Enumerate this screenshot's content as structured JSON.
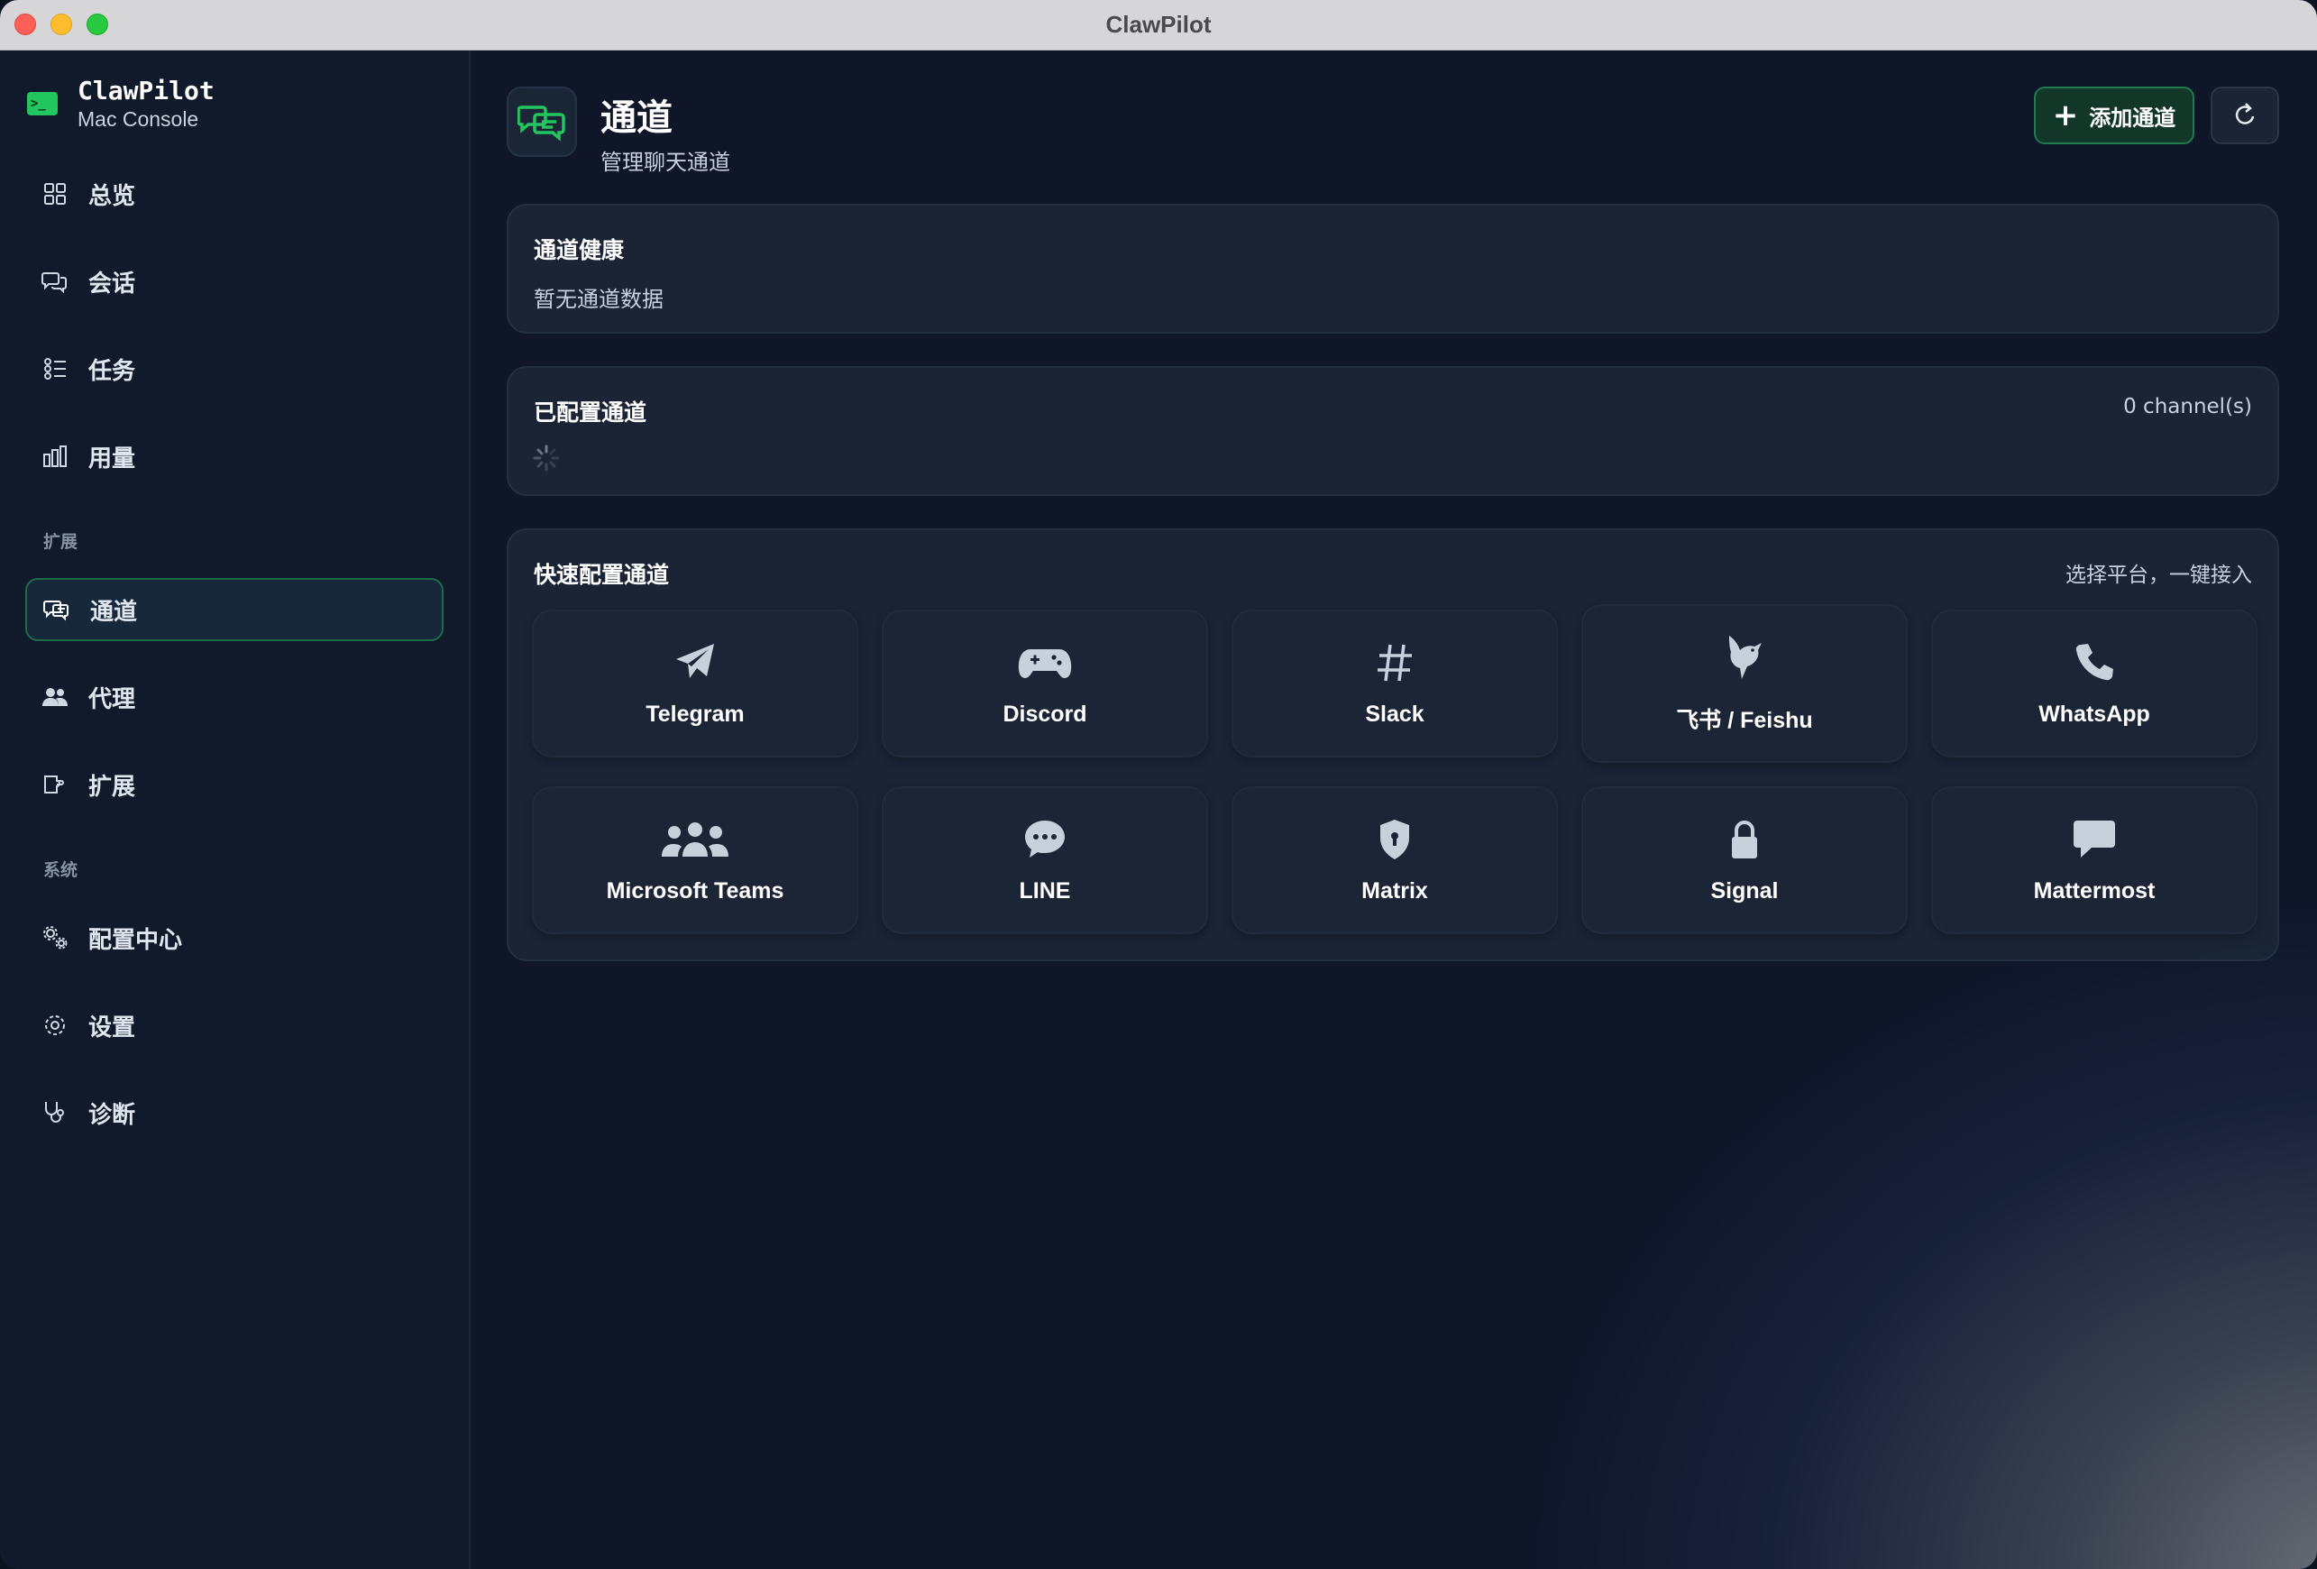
{
  "window": {
    "title": "ClawPilot"
  },
  "brand": {
    "name": "ClawPilot",
    "subtitle": "Mac Console",
    "icon": "terminal-icon"
  },
  "sidebar": {
    "items": [
      {
        "label": "总览",
        "icon": "grid-icon"
      },
      {
        "label": "会话",
        "icon": "chat-icon"
      },
      {
        "label": "任务",
        "icon": "task-list-icon"
      },
      {
        "label": "用量",
        "icon": "bar-chart-icon"
      }
    ],
    "section_ext": "扩展",
    "ext_items": [
      {
        "label": "通道",
        "icon": "channel-icon",
        "active": true
      },
      {
        "label": "代理",
        "icon": "users-icon"
      },
      {
        "label": "扩展",
        "icon": "plugin-icon"
      }
    ],
    "section_sys": "系统",
    "sys_items": [
      {
        "label": "配置中心",
        "icon": "gears-icon"
      },
      {
        "label": "设置",
        "icon": "gear-icon"
      },
      {
        "label": "诊断",
        "icon": "stethoscope-icon"
      }
    ]
  },
  "header": {
    "title": "通道",
    "subtitle": "管理聊天通道",
    "add_label": "添加通道"
  },
  "health": {
    "title": "通道健康",
    "empty": "暂无通道数据"
  },
  "configured": {
    "title": "已配置通道",
    "count": "0 channel(s)"
  },
  "quick": {
    "title": "快速配置通道",
    "hint": "选择平台，一键接入",
    "platforms": [
      {
        "label": "Telegram",
        "icon": "paper-plane-icon"
      },
      {
        "label": "Discord",
        "icon": "gamepad-icon"
      },
      {
        "label": "Slack",
        "icon": "hashtag-icon"
      },
      {
        "label": "飞书 / Feishu",
        "icon": "bird-icon"
      },
      {
        "label": "WhatsApp",
        "icon": "phone-icon"
      },
      {
        "label": "Microsoft Teams",
        "icon": "people-group-icon"
      },
      {
        "label": "LINE",
        "icon": "speech-bubble-dots-icon"
      },
      {
        "label": "Matrix",
        "icon": "shield-lock-icon"
      },
      {
        "label": "Signal",
        "icon": "padlock-icon"
      },
      {
        "label": "Mattermost",
        "icon": "message-icon"
      }
    ]
  },
  "colors": {
    "accent": "#22c55e",
    "bg": "#0e1626",
    "card": "#1b2636"
  }
}
